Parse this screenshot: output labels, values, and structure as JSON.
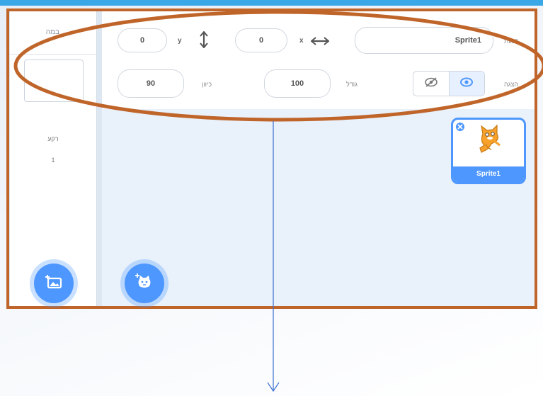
{
  "stage_panel": {
    "label": "במה",
    "backdrops_label": "רקע",
    "backdrops_count": "1"
  },
  "sprite_info": {
    "sprite_label": "דמות",
    "sprite_name": "Sprite1",
    "x_label": "x",
    "x_value": "0",
    "y_label": "y",
    "y_value": "0",
    "show_label": "הצגה",
    "size_label": "גודל",
    "size_value": "100",
    "direction_label": "כיוון",
    "direction_value": "90"
  },
  "sprites": [
    {
      "name": "Sprite1",
      "selected": true
    }
  ],
  "icons": {
    "choose_backdrop": "image-plus-icon",
    "choose_sprite": "cat-plus-icon",
    "x_arrows": "horizontal-arrows-icon",
    "y_arrows": "vertical-arrows-icon",
    "hide": "eye-slash-icon",
    "show": "eye-icon",
    "delete": "close-icon"
  },
  "colors": {
    "accent": "#4d97ff",
    "annotation": "#c0652a",
    "arrow": "#3b6fd0"
  }
}
